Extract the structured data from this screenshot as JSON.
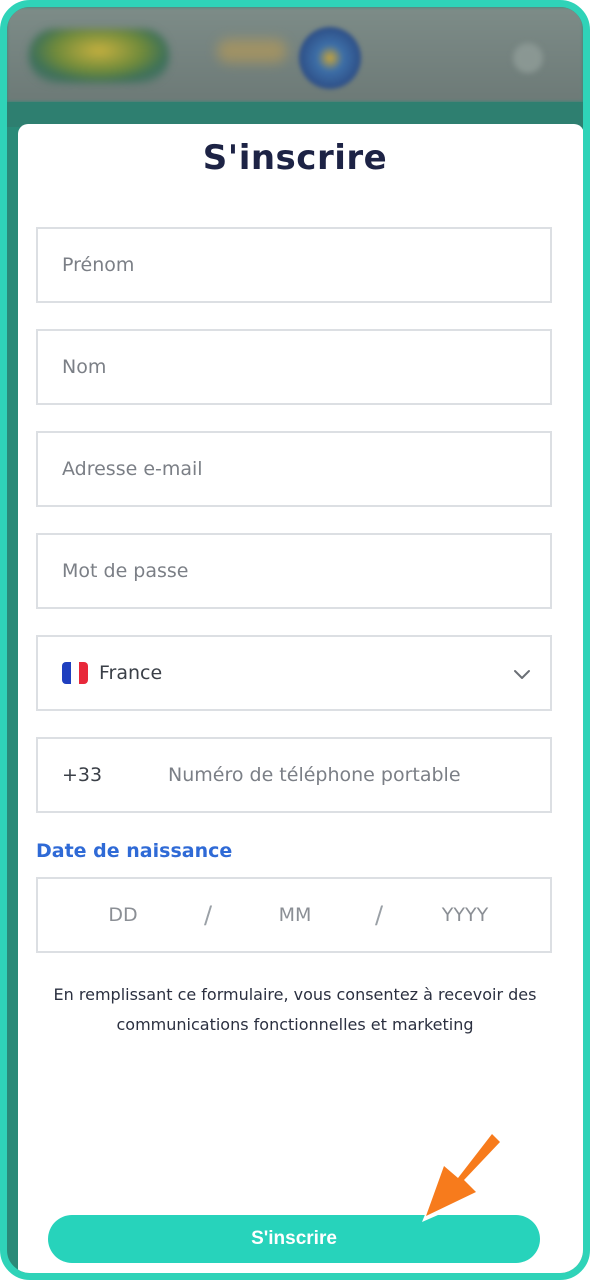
{
  "form": {
    "title": "S'inscrire",
    "first_name_placeholder": "Prénom",
    "last_name_placeholder": "Nom",
    "email_placeholder": "Adresse e-mail",
    "password_placeholder": "Mot de passe",
    "country": {
      "value": "France",
      "flag_icon": "france-flag-icon"
    },
    "phone": {
      "dial_code": "+33",
      "placeholder": "Numéro de téléphone portable"
    },
    "dob": {
      "label": "Date de naissance",
      "day_placeholder": "DD",
      "month_placeholder": "MM",
      "year_placeholder": "YYYY",
      "separator": "/"
    },
    "consent_text_line1": "En remplissant ce formulaire, vous consentez à recevoir des",
    "consent_text_line2": "communications fonctionnelles et marketing",
    "submit_label": "S'inscrire"
  },
  "colors": {
    "accent": "#27d3bb",
    "frame": "#2fd3b8",
    "title": "#1d2345",
    "label_blue": "#2f6ad6",
    "arrow": "#f77b1c"
  },
  "icons": [
    "chevron-down-icon",
    "france-flag-icon",
    "pointer-arrow-icon"
  ]
}
